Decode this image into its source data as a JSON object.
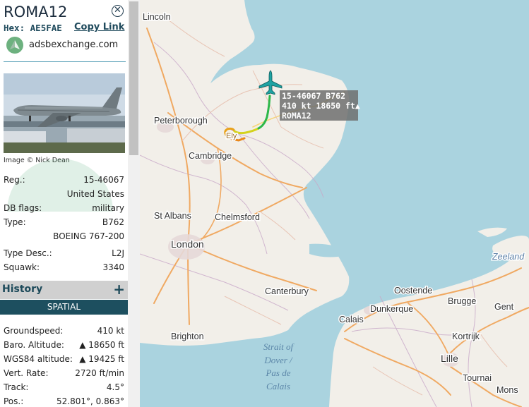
{
  "aircraft": {
    "callsign": "ROMA12",
    "hex_label": "Hex:",
    "hex": "AE5FAE",
    "copy_link": "Copy Link",
    "site": "adsbexchange.com",
    "photo_credit": "Image © Nick Dean"
  },
  "details": [
    {
      "label": "Reg.:",
      "value": "15-46067"
    },
    {
      "label": "",
      "value": "United States"
    },
    {
      "label": "DB flags:",
      "value": "military"
    },
    {
      "label": "Type:",
      "value": "B762"
    },
    {
      "label": "",
      "value": "BOEING 767-200"
    },
    {
      "label": "Type Desc.:",
      "value": "L2J"
    },
    {
      "label": "Squawk:",
      "value": "3340"
    }
  ],
  "history": {
    "title": "History",
    "plus": "+",
    "section": "SPATIAL"
  },
  "spatial": [
    {
      "label": "Groundspeed:",
      "value": "410 kt"
    },
    {
      "label": "Baro. Altitude:",
      "value": "▲ 18650 ft"
    },
    {
      "label": "WGS84 altitude:",
      "value": "▲ 19425 ft"
    },
    {
      "label": "Vert. Rate:",
      "value": "2720 ft/min"
    },
    {
      "label": "Track:",
      "value": "4.5°"
    },
    {
      "label": "Pos.:",
      "value": "52.801°, 0.863°"
    }
  ],
  "map": {
    "aircraft_label": {
      "line1": "15-46067 B762",
      "line2": "410 kt  18650 ft▲",
      "line3": "ROMA12"
    },
    "places": {
      "lincoln": "Lincoln",
      "peterborough": "Peterborough",
      "ely": "Ely",
      "cambridge": "Cambridge",
      "st_albans": "St Albans",
      "chelmsford": "Chelmsford",
      "london": "London",
      "canterbury": "Canterbury",
      "brighton": "Brighton",
      "oostende": "Oostende",
      "brugge": "Brugge",
      "gent": "Gent",
      "dunkerque": "Dunkerque",
      "calais": "Calais",
      "kortrijk": "Kortrijk",
      "lille": "Lille",
      "tournai": "Tournai",
      "mons": "Mons",
      "zeeland": "Zeeland",
      "strait1": "Strait of",
      "strait2": "Dover /",
      "strait3": "Pas de",
      "strait4": "Calais"
    }
  },
  "colors": {
    "accent": "#1d4f5f",
    "sea": "#aad3df",
    "land": "#f2efe9",
    "track_green": "#2db84a",
    "track_yellow": "#d4d21e",
    "track_orange": "#e9a21b",
    "aircraft": "#1fa3a3"
  }
}
